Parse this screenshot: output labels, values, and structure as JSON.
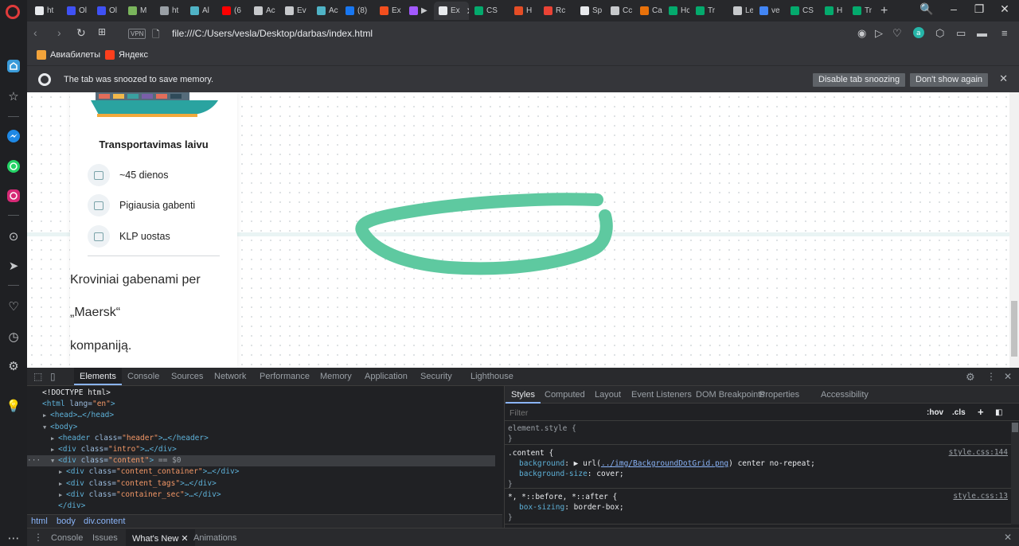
{
  "colors": {
    "accent": "#8ab4f8",
    "sketch_stroke": "#5ec9a0",
    "opera_red": "#e03b3b"
  },
  "tabs": [
    {
      "label": "ht",
      "icon": "document-icon",
      "color": "#e8eaed"
    },
    {
      "label": "Ol",
      "icon": "circle-icon",
      "color": "#3f51f5"
    },
    {
      "label": "Ol",
      "icon": "circle-icon",
      "color": "#3f51f5"
    },
    {
      "label": "M",
      "icon": "shopify-icon",
      "color": "#7ab55c"
    },
    {
      "label": "ht",
      "icon": "loading-icon",
      "color": "#9aa0a6"
    },
    {
      "label": "Al",
      "icon": "arrow-icon",
      "color": "#4fb3c6"
    },
    {
      "label": "(6",
      "icon": "youtube-icon",
      "color": "#ff0000"
    },
    {
      "label": "Ac",
      "icon": "image-icon",
      "color": "#c7c9cc"
    },
    {
      "label": "Ev",
      "icon": "image-icon",
      "color": "#c7c9cc"
    },
    {
      "label": "Ac",
      "icon": "arrow-icon",
      "color": "#4fb3c6"
    },
    {
      "label": "(8)",
      "icon": "facebook-icon",
      "color": "#1877f2"
    },
    {
      "label": "Ex",
      "icon": "figma-icon",
      "color": "#f24e1e"
    },
    {
      "label": "▶",
      "icon": "figma-icon",
      "color": "#a259ff"
    },
    {
      "label": "Ex",
      "icon": "document-icon",
      "color": "#e8eaed"
    },
    {
      "label": "CS",
      "icon": "w3-icon",
      "color": "#04aa6d"
    },
    {
      "label": "H",
      "icon": "html-icon",
      "color": "#e44d26"
    },
    {
      "label": "Rc",
      "icon": "grid-icon",
      "color": "#ea4335"
    },
    {
      "label": "Sp",
      "icon": "document-icon",
      "color": "#e8eaed"
    },
    {
      "label": "Cc",
      "icon": "image-icon",
      "color": "#c7c9cc"
    },
    {
      "label": "Ca",
      "icon": "canva-icon",
      "color": "#e8710a"
    },
    {
      "label": "Hc",
      "icon": "w3-icon",
      "color": "#04aa6d"
    },
    {
      "label": "Tr",
      "icon": "w3-icon",
      "color": "#04aa6d"
    },
    {
      "label": "Le",
      "icon": "image-icon",
      "color": "#c7c9cc"
    },
    {
      "label": "ve",
      "icon": "google-icon",
      "color": "#4285f4"
    },
    {
      "label": "CS",
      "icon": "w3-icon",
      "color": "#04aa6d"
    },
    {
      "label": "H",
      "icon": "w3-icon",
      "color": "#04aa6d"
    },
    {
      "label": "Tr",
      "icon": "w3-icon",
      "color": "#04aa6d"
    }
  ],
  "active_tab_index": 13,
  "address": {
    "vpn_label": "VPN",
    "url": "file:///C:/Users/vesla/Desktop/darbas/index.html"
  },
  "bookmarks": [
    {
      "label": "Авиабилеты",
      "icon": "plane-icon",
      "color": "#f2a33a"
    },
    {
      "label": "Яндекс",
      "icon": "yandex-icon",
      "color": "#fc3f1d"
    }
  ],
  "snooze": {
    "message": "The tab was snoozed to save memory.",
    "disable_label": "Disable tab snoozing",
    "dont_show_label": "Don't show again"
  },
  "page": {
    "card_title": "Transportavimas laivu",
    "features": [
      {
        "label": "~45 dienos",
        "icon": "calendar-icon"
      },
      {
        "label": "Pigiausia gabenti",
        "icon": "wallet-icon"
      },
      {
        "label": "KLP uostas",
        "icon": "ship-icon"
      }
    ],
    "description_lines": [
      "Kroviniai gabenami per",
      "„Maersk“",
      "kompaniją."
    ]
  },
  "devtools": {
    "tabs": [
      "Elements",
      "Console",
      "Sources",
      "Network",
      "Performance",
      "Memory",
      "Application",
      "Security",
      "Lighthouse"
    ],
    "active_tab": "Elements",
    "dom": [
      {
        "indent": 0,
        "arrow": "",
        "text": "<!DOCTYPE html>"
      },
      {
        "indent": 0,
        "arrow": "",
        "tag": "html",
        "attr": "lang",
        "val": "\"en\"",
        "tail": ">"
      },
      {
        "indent": 1,
        "arrow": "▶",
        "tag": "head",
        "tail": ">…</head>"
      },
      {
        "indent": 1,
        "arrow": "▼",
        "tag": "body",
        "tail": ">"
      },
      {
        "indent": 2,
        "arrow": "▶",
        "tag": "header",
        "attr": "class",
        "val": "\"header\"",
        "tail": ">…</header>"
      },
      {
        "indent": 2,
        "arrow": "▶",
        "tag": "div",
        "attr": "class",
        "val": "\"intro\"",
        "tail": ">…</div>"
      },
      {
        "indent": 2,
        "arrow": "▼",
        "tag": "div",
        "attr": "class",
        "val": "\"content\"",
        "tail": ">",
        "note": " == $0",
        "selected": true
      },
      {
        "indent": 3,
        "arrow": "▶",
        "tag": "div",
        "attr": "class",
        "val": "\"content_container\"",
        "tail": ">…</div>"
      },
      {
        "indent": 3,
        "arrow": "▶",
        "tag": "div",
        "attr": "class",
        "val": "\"content_tags\"",
        "tail": ">…</div>"
      },
      {
        "indent": 3,
        "arrow": "▶",
        "tag": "div",
        "attr": "class",
        "val": "\"container_sec\"",
        "tail": ">…</div>"
      },
      {
        "indent": 2,
        "arrow": "",
        "text": "</div>"
      }
    ],
    "breadcrumbs": [
      "html",
      "body",
      "div.content"
    ],
    "styles_tabs": [
      "Styles",
      "Computed",
      "Layout",
      "Event Listeners",
      "DOM Breakpoints",
      "Properties",
      "Accessibility"
    ],
    "styles_active": "Styles",
    "filter_placeholder": "Filter",
    "hov_label": ":hov",
    "cls_label": ".cls",
    "rules": [
      {
        "selector": "element.style {",
        "props": [],
        "close": "}",
        "source": ""
      },
      {
        "selector": ".content {",
        "props": [
          {
            "name": "background",
            "value_pre": "▶ url(",
            "link": "../img/BackgroundDotGrid.png",
            "value_post": ") center no-repeat;"
          },
          {
            "name": "background-size",
            "value_pre": "cover;",
            "link": "",
            "value_post": ""
          }
        ],
        "close": "}",
        "source": "style.css:144"
      },
      {
        "selector": "*, *::before, *::after {",
        "props": [
          {
            "name": "box-sizing",
            "value_pre": "border-box;",
            "link": "",
            "value_post": ""
          }
        ],
        "close": "}",
        "source": "style.css:13"
      }
    ],
    "drawer_tabs": [
      "Console",
      "Issues",
      "What's New",
      "Animations"
    ],
    "drawer_active": "What's New"
  }
}
